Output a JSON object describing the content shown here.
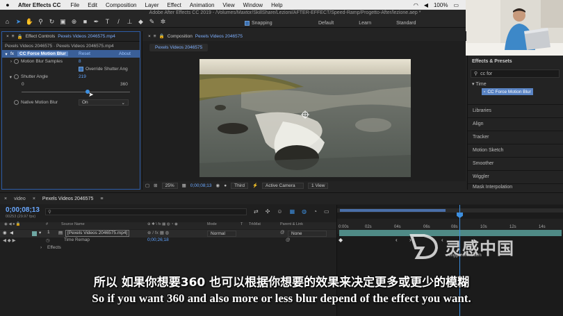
{
  "menubar": {
    "app": "After Effects CC",
    "items": [
      "File",
      "Edit",
      "Composition",
      "Layer",
      "Effect",
      "Animation",
      "View",
      "Window",
      "Help"
    ],
    "battery": "100%"
  },
  "window_title": "Adobe After Effects CC 2019 - /Volumes/Maxtor/SkillShare/Lezioni/AFTER-EFFECT/Speed-Ramp/Progetto-After/lezione.aep *",
  "toolbar": {
    "snapping": "Snapping",
    "workspaces": [
      "Default",
      "Learn",
      "Standard"
    ]
  },
  "effect_controls": {
    "tab_prefix": "Effect Controls",
    "tab_layer": "Pexels Videos 2046575.mp4",
    "subtitle": "Pexels Videos 2046575 · Pexels Videos 2046575.mp4",
    "fx_label": "fx",
    "effect_name": "CC Force Motion Blur",
    "reset": "Reset",
    "about": "About",
    "motion_blur_samples_label": "Motion Blur Samples",
    "motion_blur_samples_value": "8",
    "override_label": "Override Shutter Ang",
    "shutter_angle_label": "Shutter Angle",
    "shutter_angle_value": "219",
    "slider_min": "0",
    "slider_max": "360",
    "shutter_angle_fraction": 0.61,
    "native_label": "Native Motion Blur",
    "native_value": "On"
  },
  "composition": {
    "tab_prefix": "Composition",
    "tab_name": "Pexels Videos 2046575",
    "subtab": "Pexels Videos 2046575",
    "zoom": "25%",
    "timecode": "0;00;08;13",
    "resolution": "Third",
    "camera": "Active Camera",
    "views": "1 View"
  },
  "effects_presets": {
    "title": "Effects & Presets",
    "search": "cc for",
    "category": "Time",
    "result": "CC Force Motion Blur",
    "sections": [
      "Libraries",
      "Align",
      "Tracker",
      "Motion Sketch",
      "Smoother",
      "Wiggler",
      "Mask Interpolation"
    ]
  },
  "timeline": {
    "tabs": [
      "video",
      "Pexels Videos 2046575"
    ],
    "time": "0;00;08;13",
    "fps": "00253 (29.97 fps)",
    "header_source": "Source Name",
    "header_mode": "Mode",
    "header_t": "T",
    "header_trkmat": "TrkMat",
    "header_parent": "Parent & Link",
    "layer_num": "1",
    "layer_name": "[Pexels Videos 2046575.mp4]",
    "layer_mode": "Normal",
    "layer_parent": "None",
    "prop_time_remap": "Time Remap",
    "prop_time_remap_value": "0;00;26;18",
    "prop_effects": "Effects",
    "ruler": [
      "0:00s",
      "02s",
      "04s",
      "06s",
      "08s",
      "10s",
      "12s",
      "14s"
    ]
  },
  "subtitles": {
    "cn": "所以 如果你想要360 也可以根据你想要的效果来决定更多或更少的模糊",
    "en": "So if you want 360 and also more or less blur depend of the effect you want."
  },
  "watermark": {
    "text": "灵感中国",
    "url": "lingganchina.com"
  },
  "colors": {
    "accent": "#3d8fe0",
    "effect_highlight": "#5a84c4",
    "layer_bar": "#4f8a86"
  }
}
